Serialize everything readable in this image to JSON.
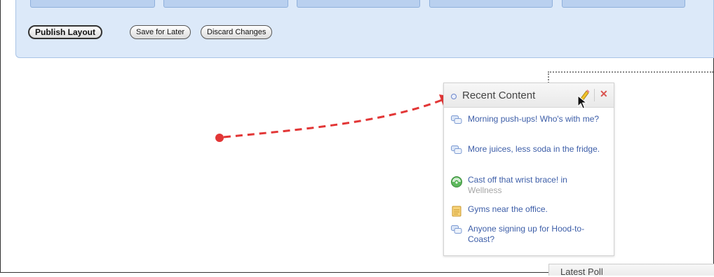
{
  "toolbar": {
    "publish_label": "Publish Layout",
    "save_label": "Save for Later",
    "discard_label": "Discard Changes"
  },
  "widget": {
    "title": "Recent Content",
    "items": [
      {
        "text": "Morning push-ups! Who's with me?",
        "icon": "discussion-icon",
        "sub": ""
      },
      {
        "text": "More juices, less soda in the fridge.",
        "icon": "discussion-icon",
        "sub": ""
      },
      {
        "text": "Cast off that wrist brace! in",
        "icon": "broadcast-icon",
        "sub": "Wellness"
      },
      {
        "text": "Gyms near the office.",
        "icon": "document-icon",
        "sub": ""
      },
      {
        "text": "Anyone signing up for Hood-to-Coast?",
        "icon": "discussion-icon",
        "sub": ""
      }
    ]
  },
  "bottom_widget": {
    "title": "Latest Poll"
  },
  "colors": {
    "toolbar_bg": "#dce9f9",
    "link": "#3d5ea8",
    "arrow": "#e23636",
    "close": "#d9534f"
  }
}
